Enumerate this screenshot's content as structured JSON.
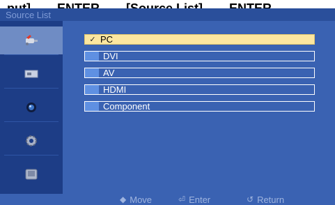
{
  "top_caption": "put]  →  ENTER  →  [Source List]  →  ENTER  →",
  "window": {
    "title": "Source List"
  },
  "sidebar": {
    "items": [
      {
        "icon": "input-plug-icon",
        "active": true
      },
      {
        "icon": "picture-icon",
        "active": false
      },
      {
        "icon": "sound-icon",
        "active": false
      },
      {
        "icon": "setup-gear-icon",
        "active": false
      },
      {
        "icon": "multi-control-icon",
        "active": false
      }
    ]
  },
  "source_list": {
    "items": [
      {
        "label": "PC",
        "selected": true,
        "check": "✓"
      },
      {
        "label": "DVI",
        "selected": false
      },
      {
        "label": "AV",
        "selected": false
      },
      {
        "label": "HDMI",
        "selected": false
      },
      {
        "label": "Component",
        "selected": false
      }
    ]
  },
  "footer": {
    "move": {
      "icon": "◆",
      "label": "Move"
    },
    "enter": {
      "icon": "⏎",
      "label": "Enter"
    },
    "return": {
      "icon": "↺",
      "label": "Return"
    }
  },
  "colors": {
    "osd_background": "#3a62b2",
    "sidebar_background": "#1d3d86",
    "selected_row": "#fce6a0",
    "marker": "#5f90e2"
  }
}
